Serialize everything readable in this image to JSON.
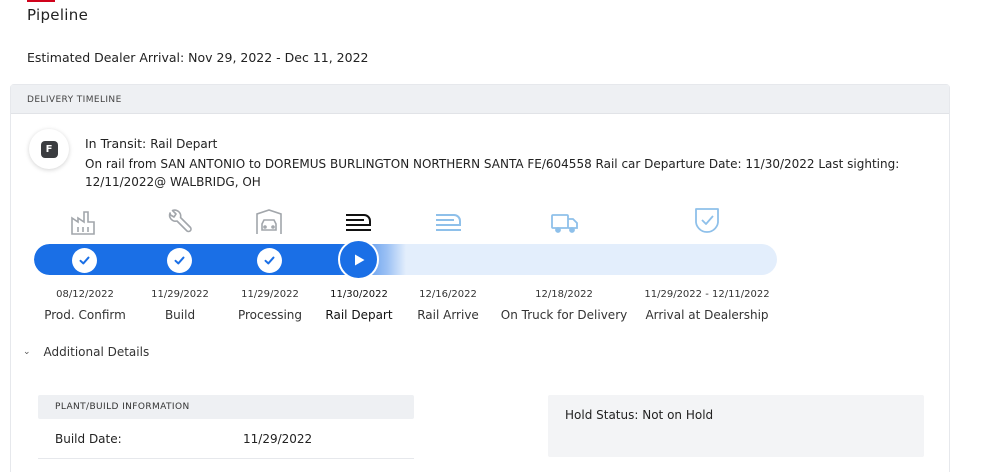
{
  "page": {
    "title": "Pipeline",
    "estimated_arrival": "Estimated Dealer Arrival: Nov 29, 2022 - Dec 11, 2022"
  },
  "timeline": {
    "header": "DELIVERY TIMELINE",
    "status_badge": "F",
    "status_prefix": "In Transit:",
    "status_value": "Rail Depart",
    "status_detail": "On rail from SAN ANTONIO to DOREMUS BURLINGTON NORTHERN SANTA FE/604558 Rail car Departure Date: 11/30/2022 Last sighting: 12/11/2022@ WALBRIDG, OH",
    "progress_fraction": 0.5,
    "stages": [
      {
        "date": "08/12/2022",
        "label": "Prod. Confirm",
        "icon": "factory-icon",
        "state": "complete"
      },
      {
        "date": "11/29/2022",
        "label": "Build",
        "icon": "wrench-icon",
        "state": "complete"
      },
      {
        "date": "11/29/2022",
        "label": "Processing",
        "icon": "car-processing-icon",
        "state": "complete"
      },
      {
        "date": "11/30/2022",
        "label": "Rail Depart",
        "icon": "rail-car-icon",
        "state": "current"
      },
      {
        "date": "12/16/2022",
        "label": "Rail Arrive",
        "icon": "rail-car-icon",
        "state": "upcoming"
      },
      {
        "date": "12/18/2022",
        "label": "On Truck for Delivery",
        "icon": "truck-icon",
        "state": "upcoming"
      },
      {
        "date": "11/29/2022 - 12/11/2022",
        "label": "Arrival at Dealership",
        "icon": "shield-check-icon",
        "state": "upcoming"
      }
    ]
  },
  "details": {
    "toggle_label": "Additional Details",
    "plant_header": "PLANT/BUILD INFORMATION",
    "build_date_label": "Build Date:",
    "build_date_value": "11/29/2022",
    "hold_status": "Hold Status: Not on Hold"
  },
  "colors": {
    "accent": "#d0021b",
    "progress": "#1a6fe6",
    "track": "#e3eefc",
    "icon_done": "#9aa0a6",
    "icon_current": "#111111",
    "icon_upcoming": "#8ec0ea"
  }
}
